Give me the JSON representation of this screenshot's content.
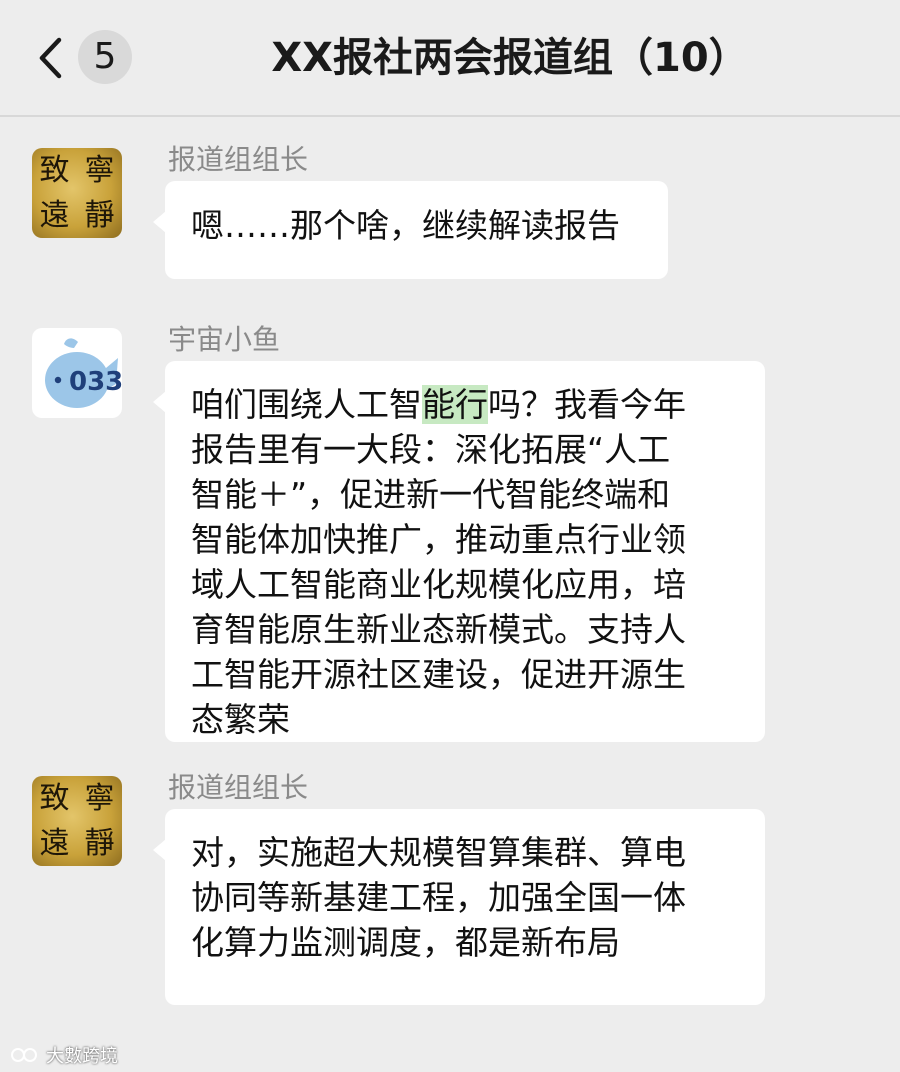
{
  "header": {
    "back_icon": "chevron-left-icon",
    "unread_count": "5",
    "title": "XX报社两会报道组（10）"
  },
  "messages": [
    {
      "sender": "报道组组长",
      "avatar": {
        "type": "calligraphy-gold",
        "chars": [
          "致",
          "寧",
          "遠",
          "靜"
        ]
      },
      "lines": [
        "嗯……那个啥，继续解读报告"
      ]
    },
    {
      "sender": "宇宙小鱼",
      "avatar": {
        "type": "fish-cartoon",
        "text": "033",
        "color": "#9cc6e8"
      },
      "lines_highlight": {
        "before": "咱们围绕人工智",
        "highlight": "能行",
        "after": "吗？我看今年"
      },
      "lines": [
        "报告里有一大段：深化拓展“人工",
        "智能＋”，促进新一代智能终端和",
        "智能体加快推广，推动重点行业领",
        "域人工智能商业化规模化应用，培",
        "育智能原生新业态新模式。支持人",
        "工智能开源社区建设，促进开源生",
        "态繁荣"
      ]
    },
    {
      "sender": "报道组组长",
      "avatar": {
        "type": "calligraphy-gold",
        "chars": [
          "致",
          "寧",
          "遠",
          "靜"
        ]
      },
      "lines": [
        "对，实施超大规模智算集群、算电",
        "协同等新基建工程，加强全国一体",
        "化算力监测调度，都是新布局"
      ]
    }
  ],
  "watermark": {
    "text": "大數跨境"
  },
  "colors": {
    "background": "#ededed",
    "bubble": "#ffffff",
    "highlight": "#c7e9c2",
    "sender_name": "#8a8a8a",
    "text": "#111111"
  }
}
